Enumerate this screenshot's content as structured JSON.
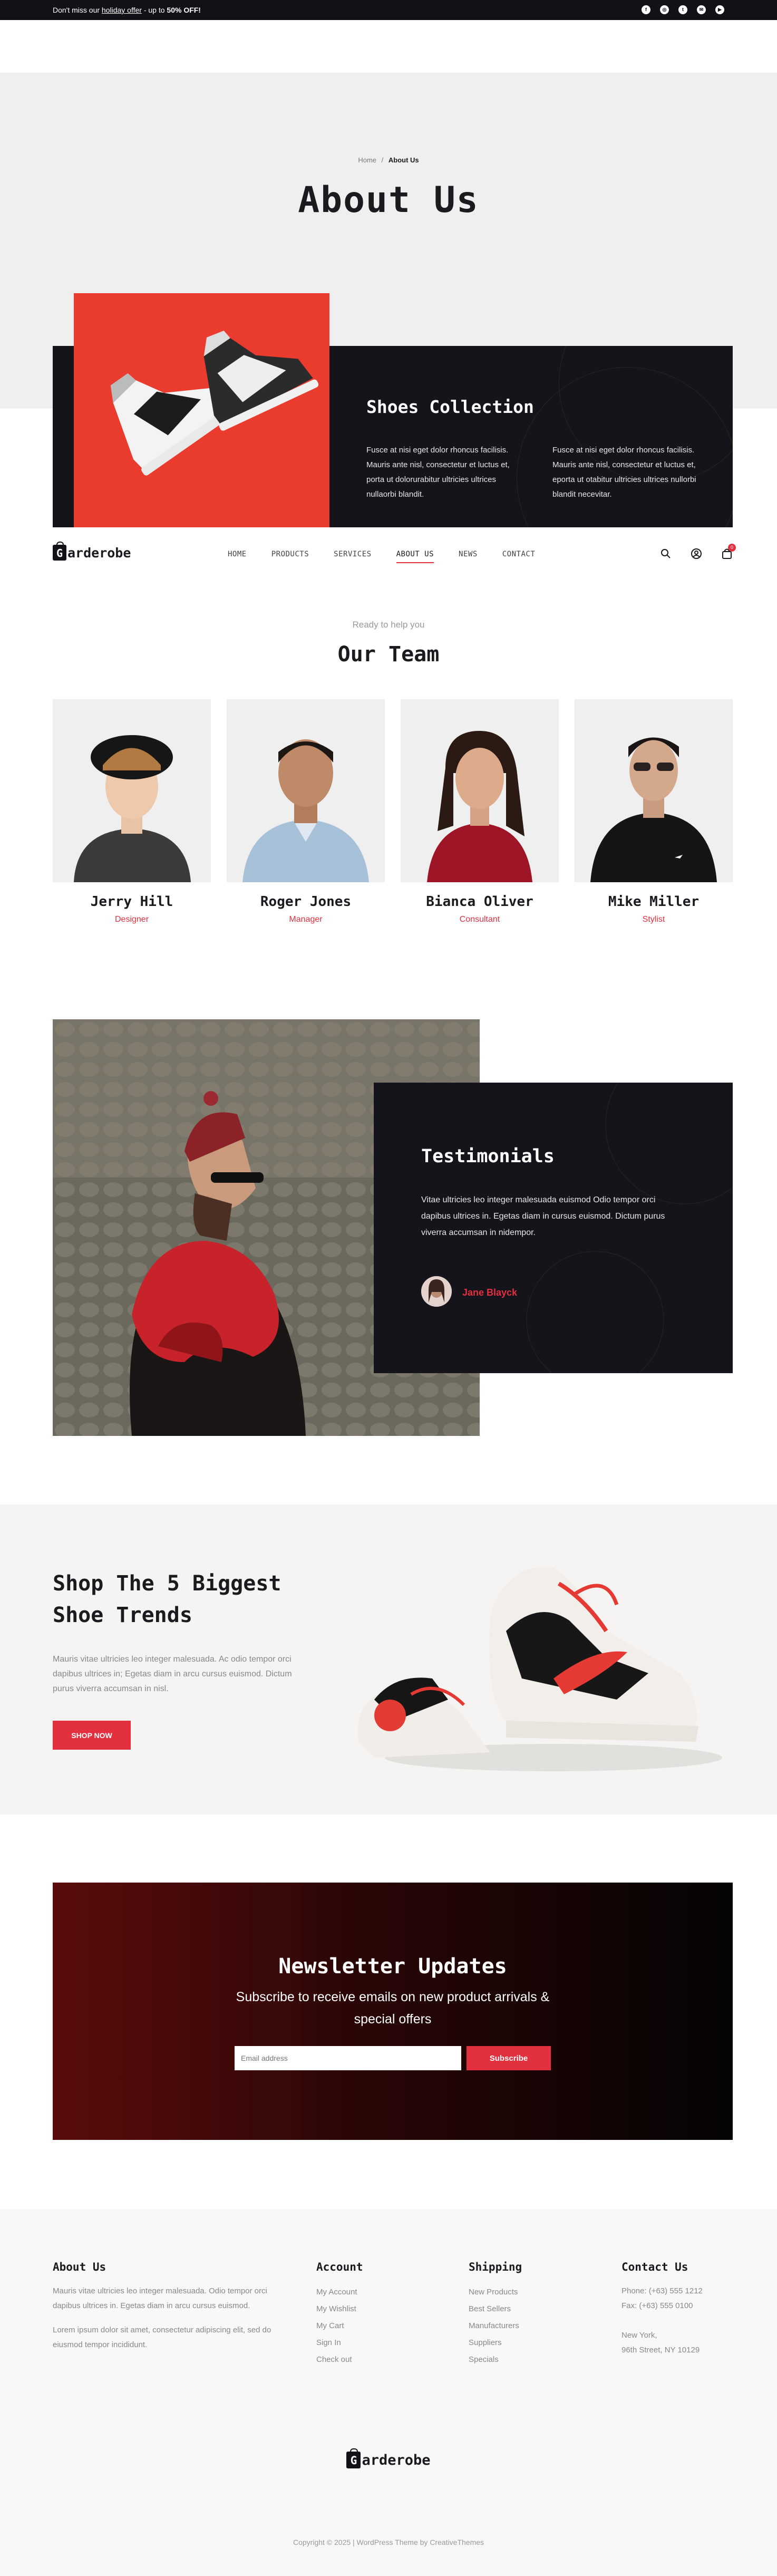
{
  "topbar": {
    "msg_pre": "Don't miss our ",
    "msg_link": "holiday offer",
    "msg_mid": " - up to ",
    "msg_bold": "50% OFF!",
    "social": [
      "facebook-icon",
      "instagram-icon",
      "twitter-icon",
      "email-icon",
      "youtube-icon"
    ]
  },
  "hero": {
    "breadcrumb_home": "Home",
    "breadcrumb_sep": "/",
    "breadcrumb_current": "About Us",
    "title": "About Us"
  },
  "collection": {
    "title": "Shoes Collection",
    "text_left": "Fusce at nisi eget dolor rhoncus facilisis. Mauris ante nisl, consectetur et luctus et, porta ut dolorurabitur ultricies ultrices nullaorbi blandit.",
    "text_right": "Fusce at nisi eget dolor rhoncus facilisis. Mauris ante nisl, consectetur et luctus et, eporta ut otabitur ultricies ultrices nullorbi blandit necevitar."
  },
  "nav": {
    "logo_letter": "G",
    "logo_rest": "arderobe",
    "items": [
      "HOME",
      "PRODUCTS",
      "SERVICES",
      "ABOUT US",
      "NEWS",
      "CONTACT"
    ],
    "active": "ABOUT US",
    "cart_count": "0"
  },
  "team": {
    "subtitle": "Ready to help you",
    "title": "Our Team",
    "members": [
      {
        "name": "Jerry Hill",
        "role": "Designer"
      },
      {
        "name": "Roger Jones",
        "role": "Manager"
      },
      {
        "name": "Bianca Oliver",
        "role": "Consultant"
      },
      {
        "name": "Mike Miller",
        "role": "Stylist"
      }
    ]
  },
  "testimonials": {
    "title": "Testimonials",
    "text": "Vitae ultricies leo integer malesuada euismod Odio tempor orci dapibus ultrices in. Egetas diam in cursus euismod. Dictum purus viverra accumsan in nidempor.",
    "author": "Jane Blayck"
  },
  "shop": {
    "title_line1": "Shop The 5 Biggest",
    "title_line2": "Shoe Trends",
    "text": "Mauris vitae ultricies leo integer malesuada. Ac odio tempor orci dapibus ultrices in; Egetas diam in arcu cursus euismod. Dictum purus viverra accumsan in nisl.",
    "button": "SHOP NOW"
  },
  "newsletter": {
    "title": "Newsletter Updates",
    "subtitle": "Subscribe to receive emails on new product arrivals & special offers",
    "placeholder": "Email address",
    "button": "Subscribe"
  },
  "footer": {
    "about": {
      "title": "About Us",
      "p1": "Mauris vitae ultricies leo integer malesuada. Odio tempor orci dapibus ultrices in. Egetas diam in arcu cursus euismod.",
      "p2": "Lorem ipsum dolor sit amet, consectetur adipiscing elit, sed do eiusmod tempor incididunt."
    },
    "account": {
      "title": "Account",
      "links": [
        "My Account",
        "My Wishlist",
        "My Cart",
        "Sign In",
        "Check out"
      ]
    },
    "shipping": {
      "title": "Shipping",
      "links": [
        "New Products",
        "Best Sellers",
        "Manufacturers",
        "Suppliers",
        "Specials"
      ]
    },
    "contact": {
      "title": "Contact Us",
      "phone": "Phone: (+63) 555 1212",
      "fax": "Fax: (+63) 555 0100",
      "addr1": "New York,",
      "addr2": "96th Street, NY 10129"
    },
    "logo_letter": "G",
    "logo_rest": "arderobe",
    "copyright": "Copyright © 2025 | WordPress Theme by CreativeThemes"
  }
}
